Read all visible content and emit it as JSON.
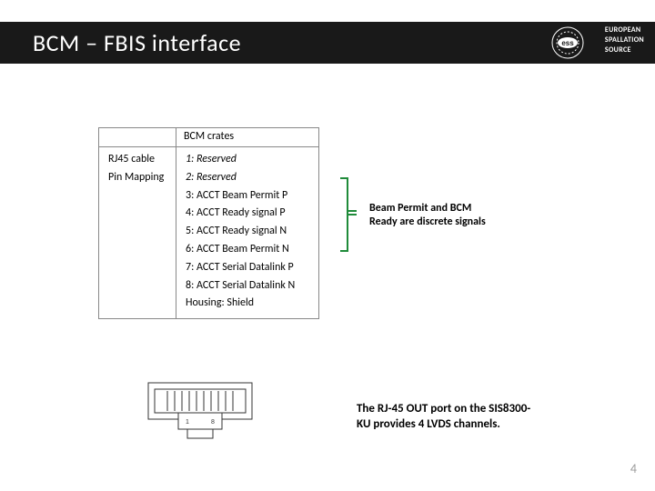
{
  "title": "BCM – FBIS interface",
  "logo_text": [
    "EUROPEAN",
    "SPALLATION",
    "SOURCE"
  ],
  "table": {
    "left_header": "",
    "right_header": "BCM crates",
    "left_rows": [
      "RJ45 cable",
      "Pin Mapping"
    ],
    "right_rows": [
      {
        "text": "1: Reserved",
        "italic": true
      },
      {
        "text": "2: Reserved",
        "italic": true
      },
      {
        "text": "3: ACCT Beam Permit P",
        "italic": false
      },
      {
        "text": "4: ACCT Ready signal P",
        "italic": false
      },
      {
        "text": "5: ACCT Ready signal N",
        "italic": false
      },
      {
        "text": "6: ACCT Beam Permit N",
        "italic": false
      },
      {
        "text": "7: ACCT Serial Datalink P",
        "italic": false
      },
      {
        "text": "8: ACCT Serial Datalink N",
        "italic": false
      },
      {
        "text": "Housing: Shield",
        "italic": false
      }
    ]
  },
  "bracket_note": "Beam Permit and BCM Ready are discrete signals",
  "rj45_note": "The RJ-45 OUT port on the SIS8300-KU provides 4 LVDS channels.",
  "page": "4",
  "colors": {
    "bracket": "#1f8b3a",
    "titlebar": "#191919"
  }
}
